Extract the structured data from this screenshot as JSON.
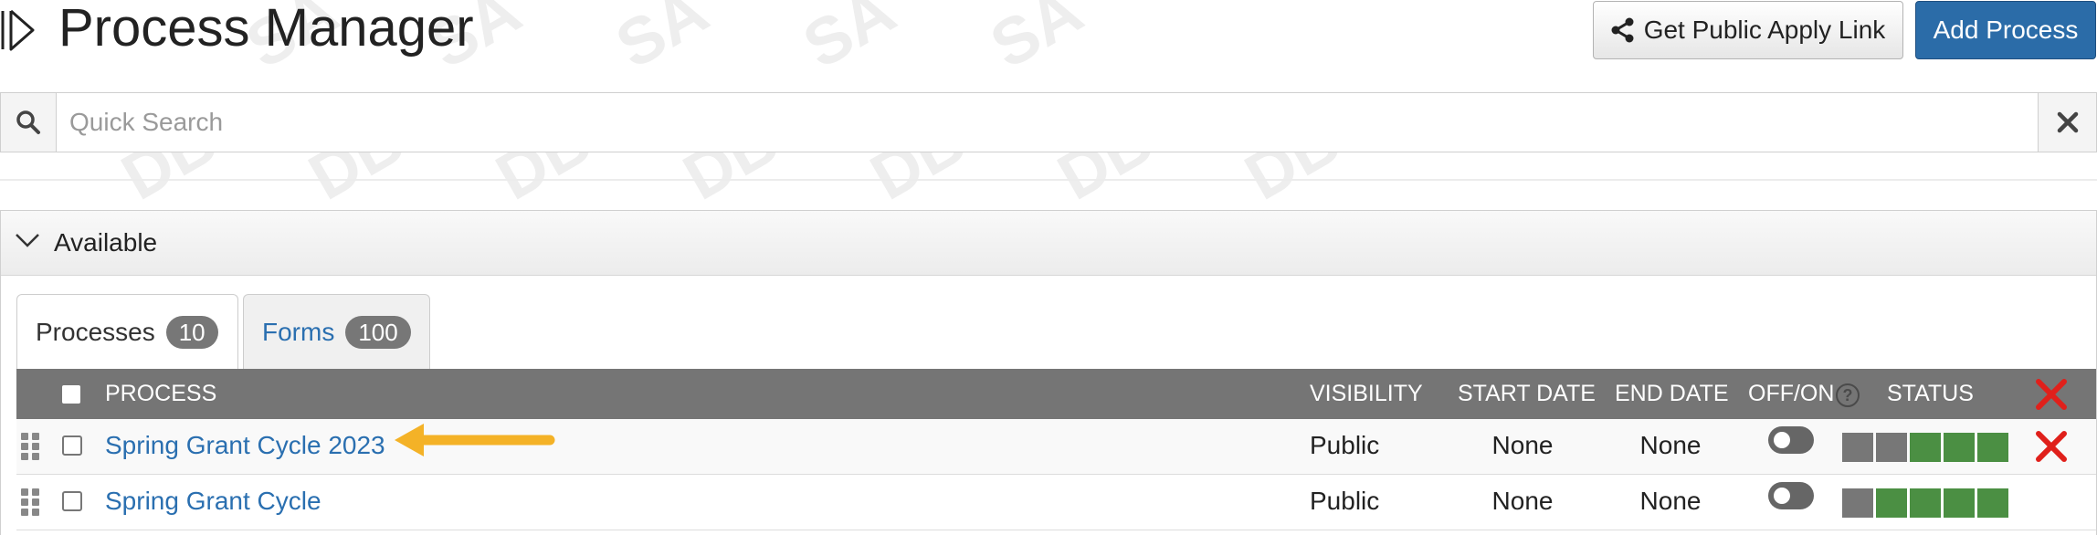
{
  "header": {
    "title": "Process Manager",
    "public_link_button": "Get Public Apply Link",
    "add_process_button": "Add Process"
  },
  "search": {
    "placeholder": "Quick Search",
    "value": ""
  },
  "panel": {
    "title": "Available"
  },
  "tabs": [
    {
      "label": "Processes",
      "count": "10",
      "active": true
    },
    {
      "label": "Forms",
      "count": "100",
      "active": false
    }
  ],
  "table": {
    "columns": {
      "process": "PROCESS",
      "visibility": "VISIBILITY",
      "start_date": "START DATE",
      "end_date": "END DATE",
      "off_on": "OFF/ON",
      "status": "STATUS"
    },
    "help_icon_symbol": "?",
    "rows": [
      {
        "name": "Spring Grant Cycle 2023",
        "visibility": "Public",
        "start_date": "None",
        "end_date": "None",
        "enabled": false,
        "status_segments": [
          "gray",
          "gray",
          "green",
          "green",
          "green"
        ],
        "deletable": true
      },
      {
        "name": "Spring Grant Cycle",
        "visibility": "Public",
        "start_date": "None",
        "end_date": "None",
        "enabled": false,
        "status_segments": [
          "gray",
          "green",
          "green",
          "green",
          "green"
        ],
        "deletable": false
      }
    ]
  },
  "colors": {
    "primary_button": "#2b6ca8",
    "link": "#2a6fb0",
    "table_header": "#757575",
    "status_gray": "#777777",
    "status_green": "#4b8f43",
    "delete_red": "#e0201b",
    "annotation_arrow": "#f4b227"
  },
  "icons": {
    "collapse": "collapse-sidebar-icon",
    "share": "share-icon",
    "search": "search-icon",
    "clear": "close-icon",
    "chevron": "chevron-down-icon",
    "drag": "drag-handle-icon",
    "delete": "delete-x-icon",
    "help": "help-icon"
  }
}
